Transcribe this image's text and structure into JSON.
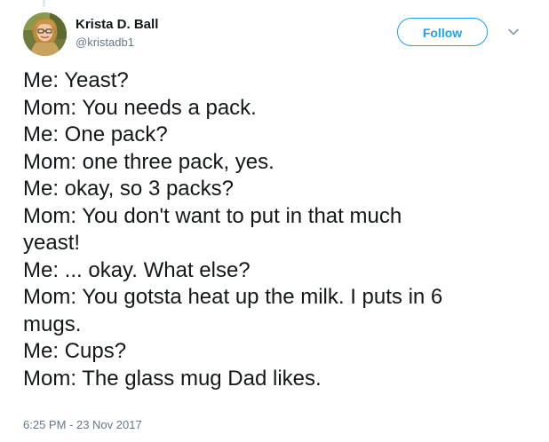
{
  "author": {
    "name": "Krista D. Ball",
    "handle": "@kristadb1",
    "avatar_icon": "user-avatar"
  },
  "header": {
    "follow_label": "Follow",
    "menu_icon": "chevron-down-icon"
  },
  "tweet": {
    "lines": [
      "Me: Yeast?",
      "Mom: You needs a pack.",
      "Me: One pack?",
      "Mom: one three pack, yes.",
      "Me: okay, so 3 packs?",
      "Mom: You don't want to put in that much",
      "yeast!",
      "Me: ... okay. What else?",
      "Mom: You gotsta heat up the milk. I puts in 6",
      "mugs.",
      "Me: Cups?",
      "Mom: The glass mug Dad likes."
    ],
    "timestamp": "6:25 PM - 23 Nov 2017"
  },
  "colors": {
    "accent": "#1da1f2",
    "text": "#14171a",
    "secondary": "#657786"
  }
}
